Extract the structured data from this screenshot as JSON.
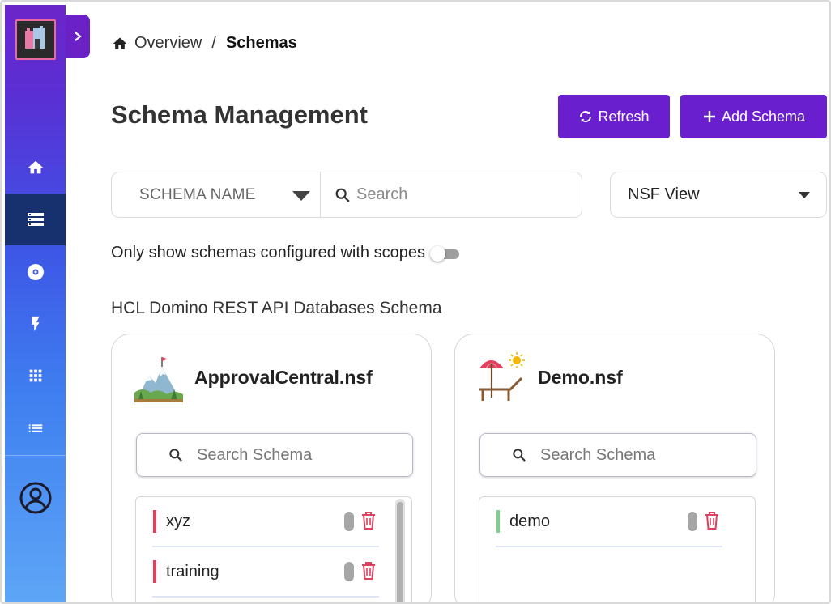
{
  "breadcrumb": {
    "home": "Overview",
    "separator": "/",
    "current": "Schemas"
  },
  "page": {
    "title": "Schema Management"
  },
  "buttons": {
    "refresh": "Refresh",
    "add_schema": "Add Schema"
  },
  "filter": {
    "select_label": "SCHEMA NAME",
    "search_placeholder": "Search"
  },
  "view_select": {
    "value": "NSF View"
  },
  "toggle": {
    "label": "Only show schemas configured with scopes",
    "on": false
  },
  "section": {
    "title": "HCL Domino REST API Databases Schema"
  },
  "sidebar": {
    "items": [
      {
        "icon": "home-icon"
      },
      {
        "icon": "storage-icon",
        "active": true
      },
      {
        "icon": "disc-icon"
      },
      {
        "icon": "bolt-icon"
      },
      {
        "icon": "apps-grid-icon"
      },
      {
        "icon": "list-icon"
      },
      {
        "icon": "account-circle-icon"
      }
    ]
  },
  "colors": {
    "accent": "#6a1fcf",
    "active_nav": "#17306e",
    "danger": "#e0405e",
    "success": "#7ed08a"
  },
  "cards": [
    {
      "title": "ApprovalCentral.nsf",
      "icon": "mountain-icon",
      "search_placeholder": "Search Schema",
      "schemas": [
        {
          "name": "xyz",
          "color": "#e0405e"
        },
        {
          "name": "training",
          "color": "#e0405e"
        }
      ]
    },
    {
      "title": "Demo.nsf",
      "icon": "beach-chair-icon",
      "search_placeholder": "Search Schema",
      "schemas": [
        {
          "name": "demo",
          "color": "#7ed08a"
        }
      ]
    }
  ]
}
